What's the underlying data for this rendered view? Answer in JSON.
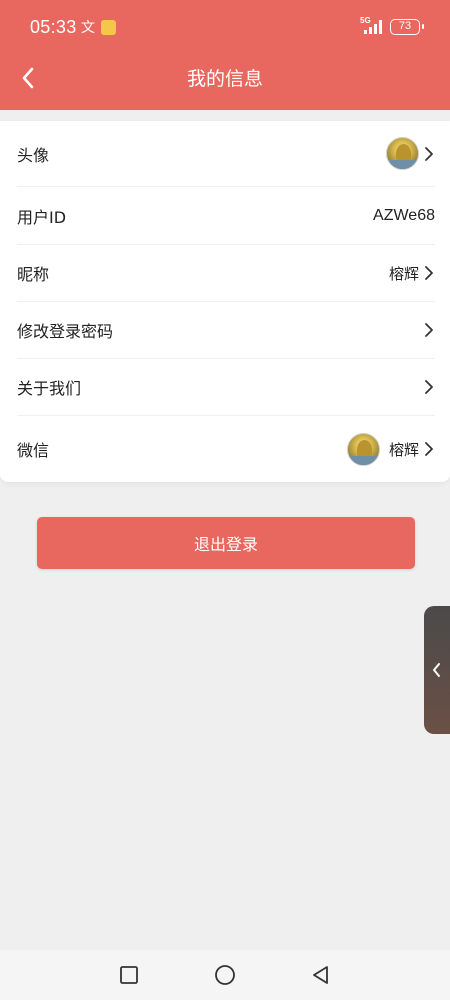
{
  "status_bar": {
    "time": "05:33",
    "wen_icon": "文",
    "network": "5G",
    "battery": "73"
  },
  "header": {
    "title": "我的信息"
  },
  "rows": [
    {
      "label": "头像",
      "value": ""
    },
    {
      "label": "用户ID",
      "value": "AZWe68"
    },
    {
      "label": "昵称",
      "value": "榕辉"
    },
    {
      "label": "修改登录密码",
      "value": ""
    },
    {
      "label": "关于我们",
      "value": ""
    },
    {
      "label": "微信",
      "value": "榕辉"
    }
  ],
  "logout_label": "退出登录",
  "colors": {
    "accent": "#e8675f",
    "background": "#efefef",
    "card": "#ffffff"
  },
  "icons": {
    "back": "chevron-left-icon",
    "row_arrow": "chevron-right-icon",
    "side_tab": "chevron-left-icon",
    "nav_recent": "square-icon",
    "nav_home": "circle-icon",
    "nav_back": "triangle-back-icon"
  }
}
